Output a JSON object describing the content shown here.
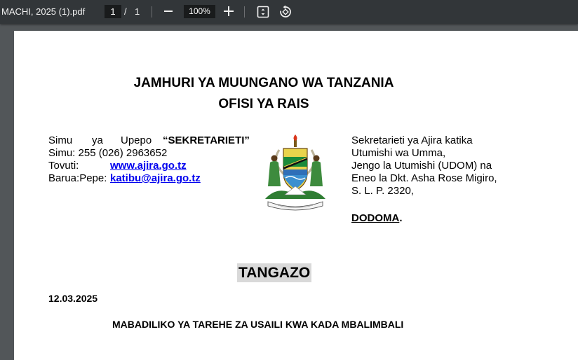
{
  "toolbar": {
    "file_title": "MACHI, 2025 (1).pdf",
    "page_current": "1",
    "page_separator": "/",
    "page_total": "1",
    "zoom_level": "100%",
    "icons": [
      "zoom-out-icon",
      "zoom-in-icon",
      "fit-page-icon",
      "rotate-icon"
    ]
  },
  "document": {
    "header_line1": "JAMHURI YA MUUNGANO WA TANZANIA",
    "header_line2": "OFISI YA RAIS",
    "contacts": {
      "simu_ya": "Simu",
      "ya": "ya",
      "upepo": "Upepo",
      "telegram": "“SEKRETARIETI”",
      "simu": "Simu: 255 (026) 2963652",
      "tovuti_label": "Tovuti:",
      "tovuti_value": "www.ajira.go.tz",
      "barua_label": "Barua:Pepe:",
      "barua_value": "katibu@ajira.go.tz"
    },
    "address": [
      "Sekretarieti ya Ajira katika",
      "Utumishi wa Umma,",
      "Jengo la Utumishi (UDOM) na",
      "Eneo la Dkt. Asha Rose Migiro,",
      "S. L. P.  2320,"
    ],
    "city": "DODOMA",
    "city_suffix": ".",
    "title": "TANGAZO",
    "date": "12.03.2025",
    "subject": "MABADILIKO YA TAREHE ZA USAILI KWA KADA MBALIMBALI"
  },
  "colors": {
    "toolbar_bg": "#323639",
    "viewer_bg": "#525659",
    "link": "#0000ee",
    "highlight": "#d9d9d9"
  }
}
